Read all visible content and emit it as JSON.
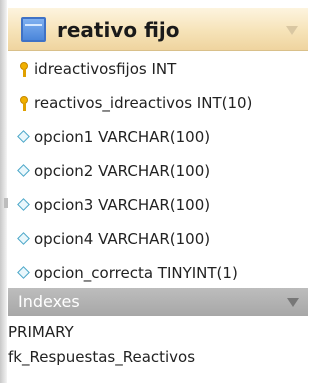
{
  "table": {
    "name": "reativo fijo",
    "icon": "table-icon"
  },
  "columns": [
    {
      "icon": "key-icon",
      "text": "idreactivosfijos INT"
    },
    {
      "icon": "key-icon",
      "text": "reactivos_idreactivos INT(10)"
    },
    {
      "icon": "diamond-icon",
      "text": "opcion1 VARCHAR(100)"
    },
    {
      "icon": "diamond-icon",
      "text": "opcion2 VARCHAR(100)"
    },
    {
      "icon": "diamond-icon",
      "text": "opcion3 VARCHAR(100)"
    },
    {
      "icon": "diamond-icon",
      "text": "opcion4 VARCHAR(100)"
    },
    {
      "icon": "diamond-icon",
      "text": "opcion_correcta TINYINT(1)"
    }
  ],
  "indexes": {
    "title": "Indexes",
    "items": [
      "PRIMARY",
      "fk_Respuestas_Reactivos"
    ]
  },
  "colors": {
    "header_gradient": [
      "#fdf4df",
      "#efd49f"
    ],
    "key": "#f1b000",
    "diamond": "#4aa6c8",
    "indexes_header": "#b3b3b3"
  }
}
